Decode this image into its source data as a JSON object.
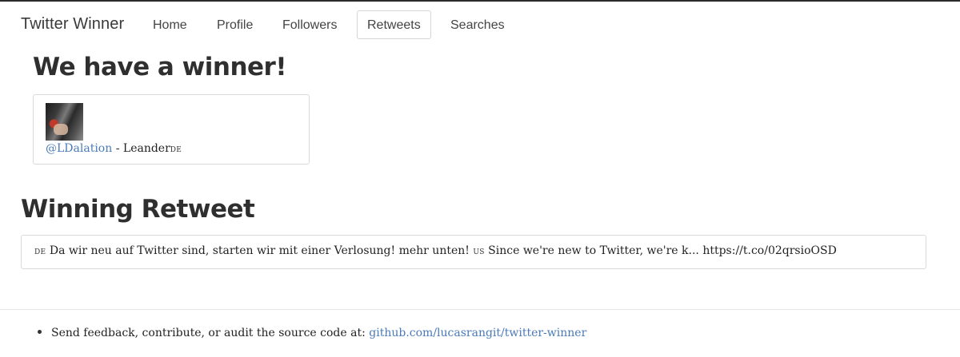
{
  "navbar": {
    "brand": "Twitter Winner",
    "items": [
      {
        "label": "Home",
        "active": false
      },
      {
        "label": "Profile",
        "active": false
      },
      {
        "label": "Followers",
        "active": false
      },
      {
        "label": "Retweets",
        "active": true
      },
      {
        "label": "Searches",
        "active": false
      }
    ]
  },
  "winner": {
    "heading": "We have a winner!",
    "handle": "@LDalation",
    "separator": " - ",
    "name": "Leander",
    "flag": "DE"
  },
  "retweet": {
    "heading": "Winning Retweet",
    "flag_de": "DE",
    "text_de": " Da wir neu auf Twitter sind, starten wir mit einer Verlosung! mehr unten! ",
    "flag_us": "US",
    "text_us": " Since we're new to Twitter, we're k... https://t.co/02qrsioOSD"
  },
  "footer": {
    "text": "Send feedback, contribute, or audit the source code at: ",
    "link": "github.com/lucasrangit/twitter-winner"
  },
  "colors": {
    "link": "#4a7ab8",
    "text": "#2b2b2b",
    "border": "#dadada"
  }
}
